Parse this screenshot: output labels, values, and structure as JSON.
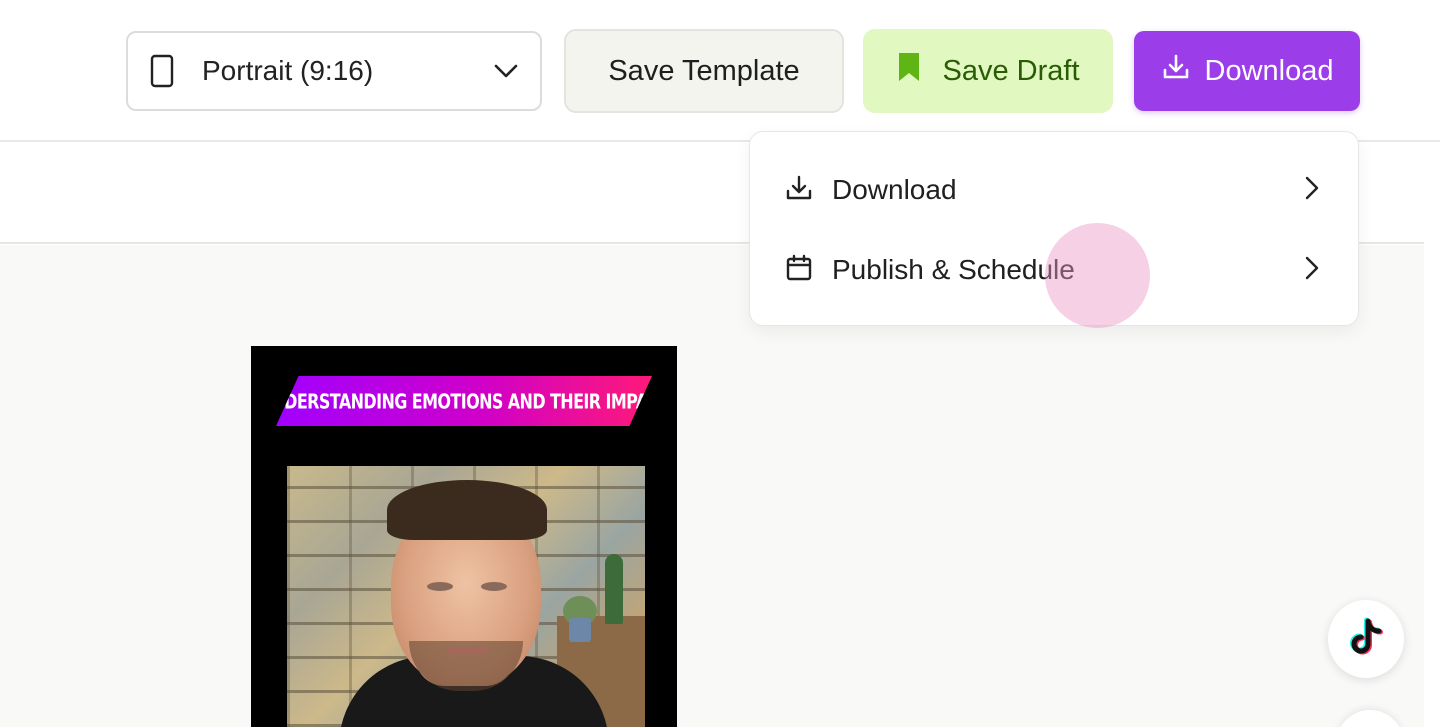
{
  "toolbar": {
    "aspect_select": {
      "value": "Portrait (9:16)",
      "icon": "phone-portrait-icon"
    },
    "save_template_label": "Save Template",
    "save_draft_label": "Save Draft",
    "download_label": "Download"
  },
  "download_menu": {
    "items": [
      {
        "label": "Download",
        "icon": "download-icon"
      },
      {
        "label": "Publish & Schedule",
        "icon": "calendar-icon"
      }
    ]
  },
  "preview": {
    "title_banner": "UNDERSTANDING EMOTIONS AND THEIR IMPACT"
  },
  "floating": {
    "tiktok_icon": "tiktok-icon"
  },
  "colors": {
    "download_accent": "#9b3de8",
    "draft_bg": "#e1f9c0",
    "draft_text": "#2a5c06",
    "bookmark": "#5fb513",
    "banner_start": "#a100ff",
    "banner_end": "#ff1a78"
  }
}
